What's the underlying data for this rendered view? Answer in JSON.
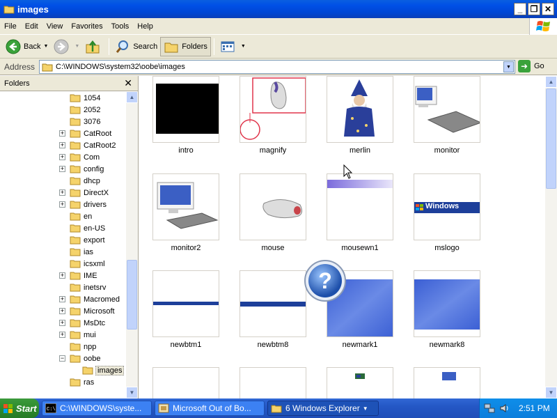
{
  "window": {
    "title": "images"
  },
  "menu": [
    "File",
    "Edit",
    "View",
    "Favorites",
    "Tools",
    "Help"
  ],
  "toolbar": {
    "back": "Back",
    "search": "Search",
    "folders": "Folders"
  },
  "address": {
    "label": "Address",
    "path": "C:\\WINDOWS\\system32\\oobe\\images",
    "go": "Go"
  },
  "folders_pane": {
    "title": "Folders",
    "items": [
      {
        "label": "1054",
        "expander": ""
      },
      {
        "label": "2052",
        "expander": ""
      },
      {
        "label": "3076",
        "expander": ""
      },
      {
        "label": "CatRoot",
        "expander": "+"
      },
      {
        "label": "CatRoot2",
        "expander": "+"
      },
      {
        "label": "Com",
        "expander": "+"
      },
      {
        "label": "config",
        "expander": "+"
      },
      {
        "label": "dhcp",
        "expander": ""
      },
      {
        "label": "DirectX",
        "expander": "+"
      },
      {
        "label": "drivers",
        "expander": "+"
      },
      {
        "label": "en",
        "expander": ""
      },
      {
        "label": "en-US",
        "expander": ""
      },
      {
        "label": "export",
        "expander": ""
      },
      {
        "label": "ias",
        "expander": ""
      },
      {
        "label": "icsxml",
        "expander": ""
      },
      {
        "label": "IME",
        "expander": "+"
      },
      {
        "label": "inetsrv",
        "expander": ""
      },
      {
        "label": "Macromed",
        "expander": "+"
      },
      {
        "label": "Microsoft",
        "expander": "+"
      },
      {
        "label": "MsDtc",
        "expander": "+"
      },
      {
        "label": "mui",
        "expander": "+"
      },
      {
        "label": "npp",
        "expander": ""
      },
      {
        "label": "oobe",
        "expander": "−"
      },
      {
        "label": "images",
        "expander": "",
        "selected": true
      },
      {
        "label": "ras",
        "expander": ""
      }
    ]
  },
  "thumbnails": [
    {
      "name": "intro"
    },
    {
      "name": "magnify"
    },
    {
      "name": "merlin"
    },
    {
      "name": "monitor"
    },
    {
      "name": "monitor2"
    },
    {
      "name": "mouse"
    },
    {
      "name": "mousewn1"
    },
    {
      "name": "mslogo"
    },
    {
      "name": "newbtm1"
    },
    {
      "name": "newbtm8"
    },
    {
      "name": "newmark1"
    },
    {
      "name": "newmark8"
    },
    {
      "name": ""
    },
    {
      "name": ""
    },
    {
      "name": ""
    },
    {
      "name": ""
    }
  ],
  "mslogo_text": "Windows",
  "taskbar": {
    "start": "Start",
    "tasks": [
      "C:\\WINDOWS\\syste...",
      "Microsoft Out of Bo...",
      "6 Windows Explorer"
    ],
    "clock": "2:51 PM"
  },
  "colors": {
    "titlebar": "#0050e6",
    "taskbar": "#2457c5",
    "start": "#2e8b2e",
    "chrome": "#ece9d8"
  }
}
